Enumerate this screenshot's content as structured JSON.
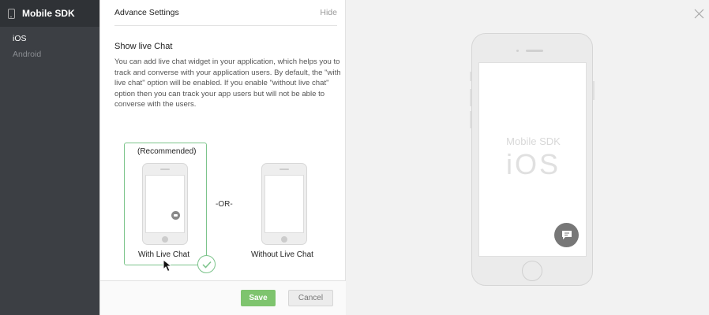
{
  "sidebar": {
    "title": "Mobile SDK",
    "items": [
      {
        "label": "iOS",
        "active": true
      },
      {
        "label": "Android",
        "active": false
      }
    ]
  },
  "settings": {
    "header_title": "Advance Settings",
    "hide_label": "Hide",
    "section_title": "Show live Chat",
    "description": "You can add live chat widget in your application, which helps you to track and converse with your application users. By default, the \"with live chat\" option will be enabled. If you enable \"without live chat\" option then you can track your app users but will not be able to converse with the users.",
    "options": {
      "recommended_label": "(Recommended)",
      "or_label": "-OR-",
      "with_chat_label": "With Live Chat",
      "without_chat_label": "Without Live Chat",
      "selected": "With Live Chat"
    },
    "save_label": "Save",
    "cancel_label": "Cancel"
  },
  "preview": {
    "title": "Mobile SDK",
    "platform": "iOS"
  },
  "colors": {
    "accent_green": "#7ec46e",
    "sidebar_bg": "#3c3f44",
    "selected_border": "#7cc48b"
  },
  "icons": {
    "sidebar": "mobile-phone-icon",
    "close": "close-icon",
    "chat": "chat-bubble-icon",
    "check": "check-icon"
  }
}
